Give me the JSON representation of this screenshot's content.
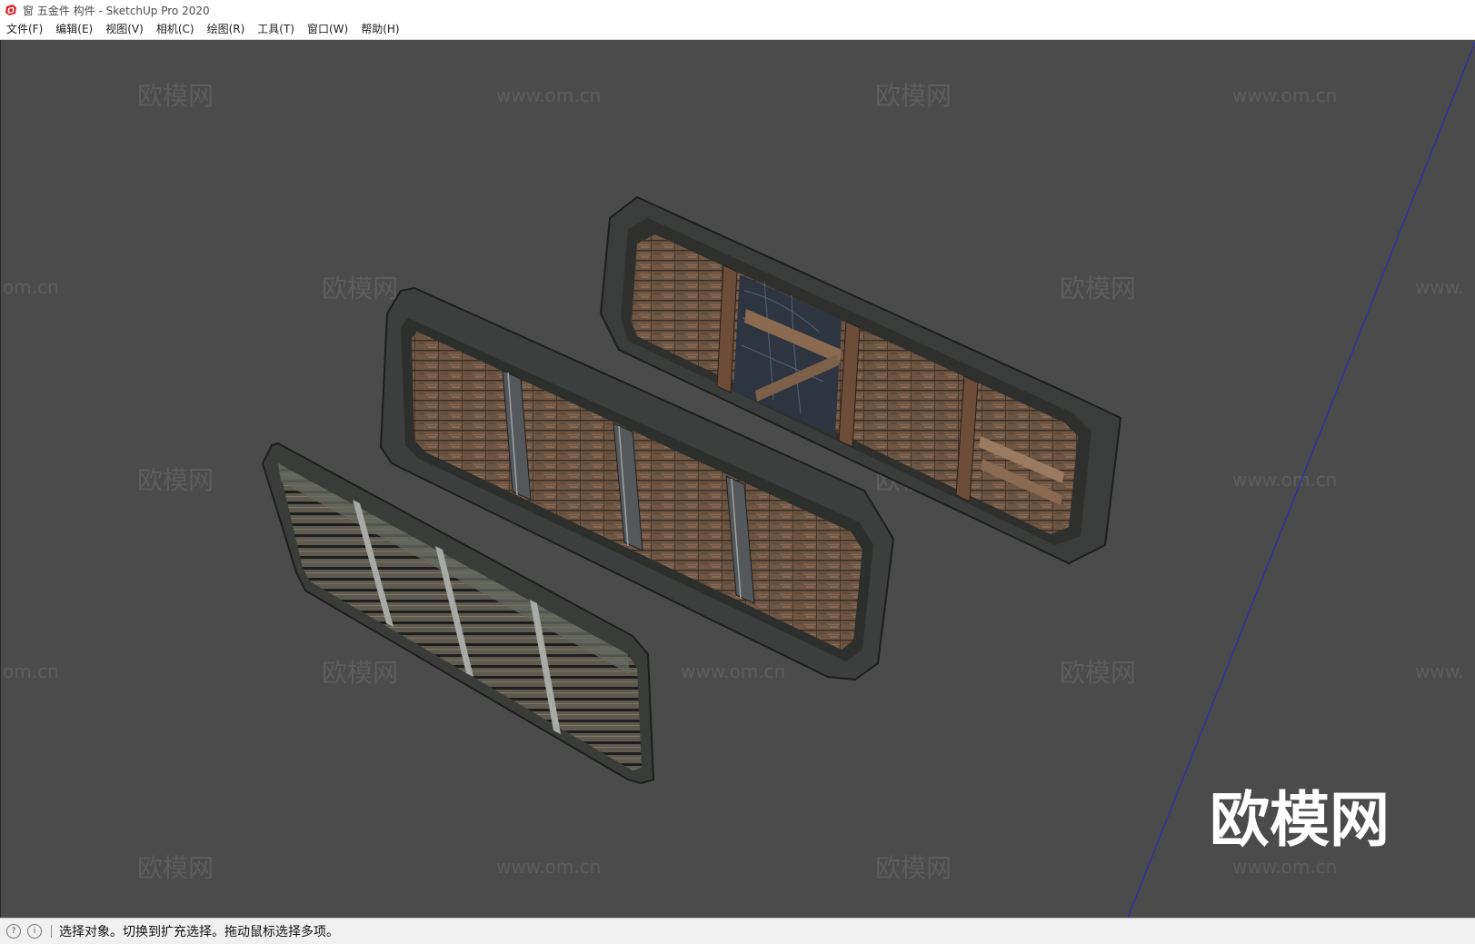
{
  "window": {
    "title": "窗 五金件 构件 - SketchUp Pro 2020"
  },
  "menu": {
    "items": [
      "文件(F)",
      "编辑(E)",
      "视图(V)",
      "相机(C)",
      "绘图(R)",
      "工具(T)",
      "窗口(W)",
      "帮助(H)"
    ]
  },
  "watermark": {
    "brand": "欧模网",
    "url": "www.om.cn",
    "url_partial_left": "om.cn",
    "url_partial_right": "www."
  },
  "status": {
    "icon_left": "geo-location-icon",
    "icon_info": "info-icon",
    "message": "选择对象。切换到扩充选择。拖动鼠标选择多项。"
  },
  "colors": {
    "viewport_bg": "#4b4b4b",
    "axis_blue": "#2a2ab8",
    "frame_dark": "#3c3f3d",
    "wood": "#7a5c45"
  }
}
